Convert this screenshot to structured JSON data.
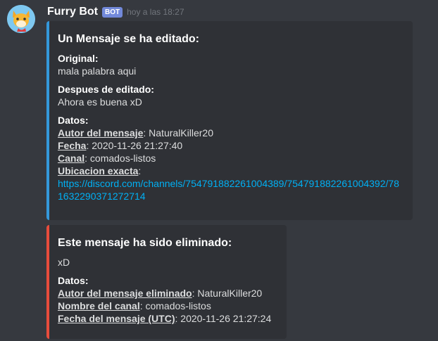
{
  "message": {
    "username": "Furry Bot",
    "bot_tag": "BOT",
    "timestamp": "hoy a las 18:27"
  },
  "edit_embed": {
    "accent_color": "#3498db",
    "title": "Un Mensaje se ha editado:",
    "original_label": "Original:",
    "original_value": "mala palabra aqui",
    "edited_label": "Despues de editado:",
    "edited_value": "Ahora es buena xD",
    "data_label": "Datos:",
    "author_key": "Autor del mensaje",
    "author_value": ": NaturalKiller20",
    "date_key": "Fecha",
    "date_value": ": 2020-11-26 21:27:40",
    "channel_key": "Canal",
    "channel_value": ": comados-listos",
    "location_key": "Ubicacion exacta",
    "location_sep": ":",
    "location_link": "https://discord.com/channels/754791882261004389/754791882261004392/781632290371272714"
  },
  "delete_embed": {
    "accent_color": "#e74c3c",
    "title": "Este mensaje ha sido eliminado:",
    "content": "xD",
    "data_label": "Datos:",
    "author_key": "Autor del mensaje eliminado",
    "author_value": ": NaturalKiller20",
    "channel_key": "Nombre del canal",
    "channel_value": ": comados-listos",
    "date_key": "Fecha del mensaje (UTC)",
    "date_value": ": 2020-11-26 21:27:24"
  }
}
